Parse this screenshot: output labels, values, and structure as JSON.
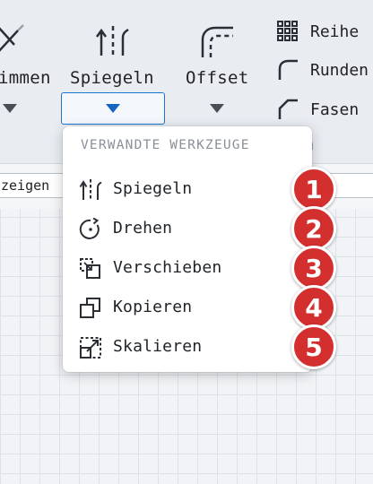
{
  "ribbon": {
    "trim_label": "immen",
    "mirror_label": "Spiegeln",
    "offset_label": "Offset",
    "side_items": [
      {
        "label": "Reihe",
        "icon": "grid-array-icon"
      },
      {
        "label": "Runden",
        "icon": "fillet-icon"
      },
      {
        "label": "Fasen",
        "icon": "chamfer-icon"
      }
    ],
    "hidden_label": "en"
  },
  "toolbar2": {
    "field_text": "zeigen"
  },
  "dropdown": {
    "header": "VERWANDTE WERKZEUGE",
    "items": [
      {
        "label": "Spiegeln",
        "icon": "mirror-icon",
        "badge": "1"
      },
      {
        "label": "Drehen",
        "icon": "rotate-icon",
        "badge": "2"
      },
      {
        "label": "Verschieben",
        "icon": "move-icon",
        "badge": "3"
      },
      {
        "label": "Kopieren",
        "icon": "copy-icon",
        "badge": "4"
      },
      {
        "label": "Skalieren",
        "icon": "scale-icon",
        "badge": "5"
      }
    ]
  },
  "colors": {
    "accent": "#1976d2",
    "badge": "#d32f2f"
  }
}
